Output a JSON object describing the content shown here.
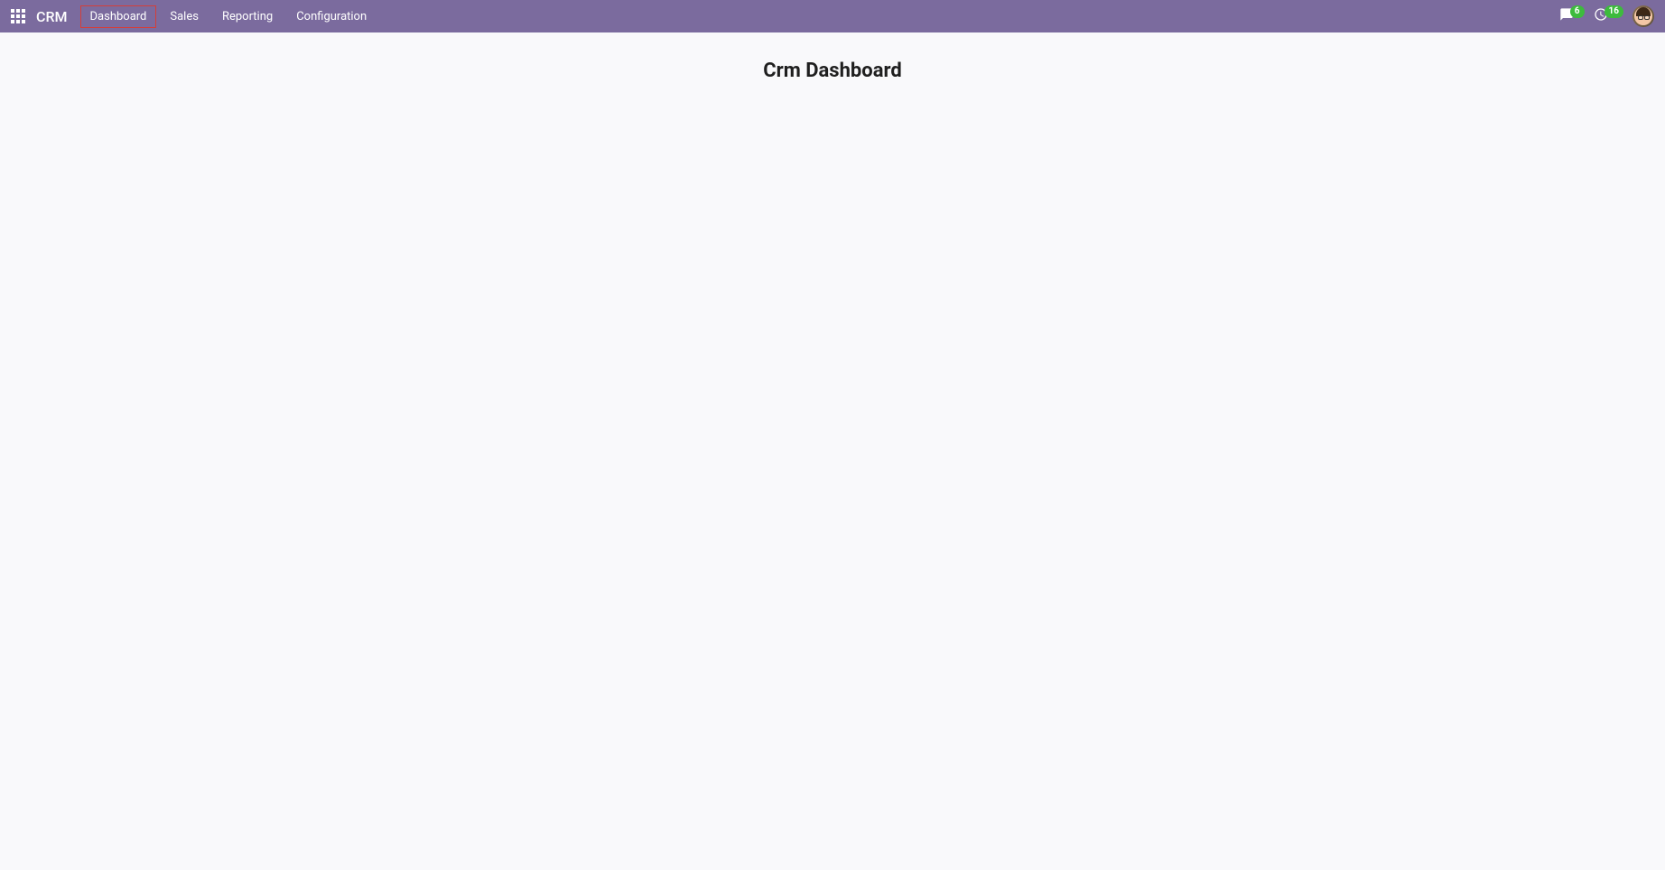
{
  "navbar": {
    "brand": "CRM",
    "items": [
      {
        "label": "Dashboard",
        "highlighted": true
      },
      {
        "label": "Sales",
        "highlighted": false
      },
      {
        "label": "Reporting",
        "highlighted": false
      },
      {
        "label": "Configuration",
        "highlighted": false
      }
    ],
    "messages_badge": "6",
    "activities_badge": "16"
  },
  "page": {
    "title": "Crm Dashboard"
  },
  "colors": {
    "navbar_bg": "#7b6b9e",
    "badge_bg": "#3dbb3d",
    "highlight_border": "#d43f3a"
  }
}
